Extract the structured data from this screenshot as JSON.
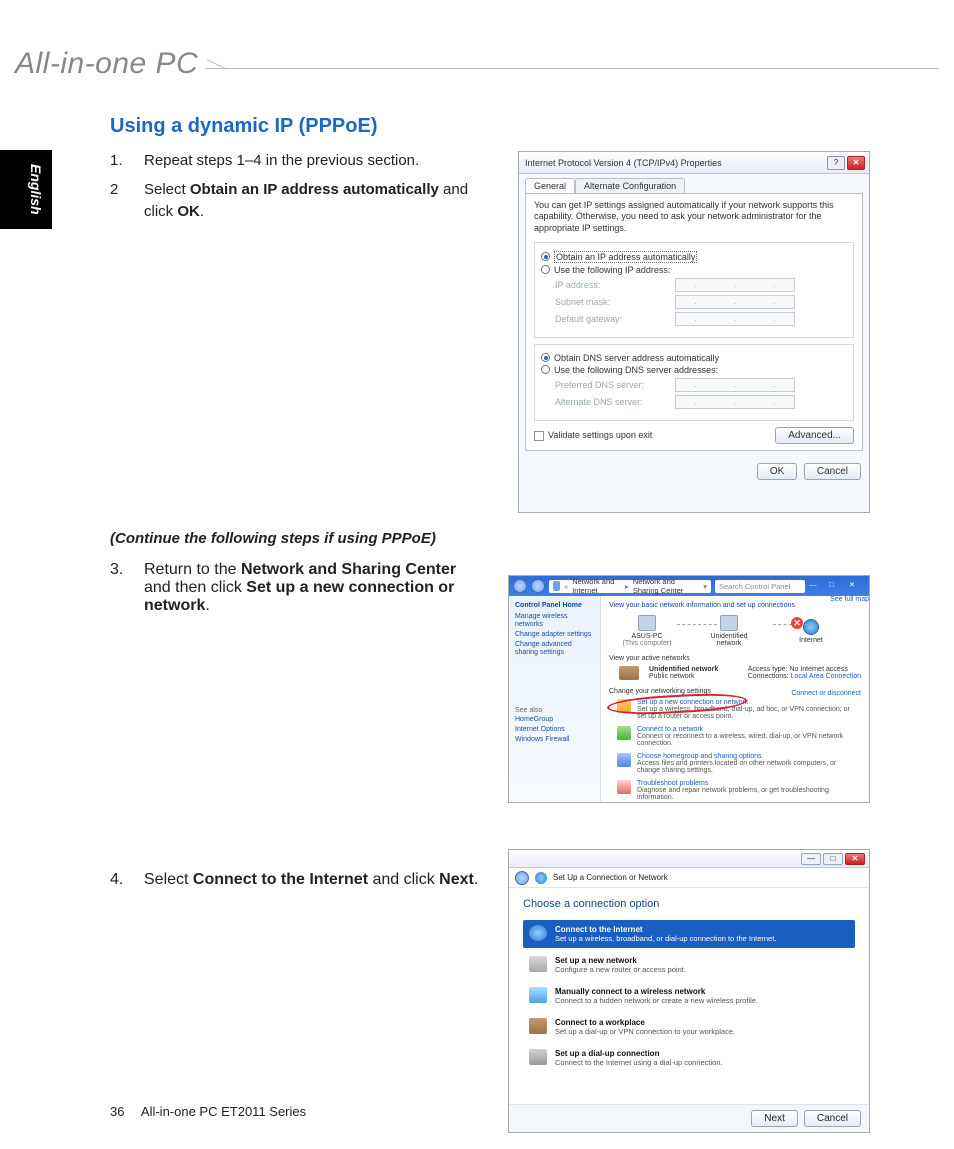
{
  "header": {
    "product": "All-in-one PC"
  },
  "lang_tab": "English",
  "section_title": "Using a dynamic IP (PPPoE)",
  "steps": {
    "s1": {
      "n": "1.",
      "t": "Repeat steps 1–4 in the previous section."
    },
    "s2": {
      "n": "2",
      "pre": "Select ",
      "b1": "Obtain an IP address automatically",
      "mid": " and click ",
      "b2": "OK",
      "post": "."
    },
    "cont": "(Continue the following steps if using PPPoE)",
    "s3": {
      "n": "3.",
      "pre": "Return to the ",
      "b1": "Network and Sharing Center",
      "mid": " and then click ",
      "b2": "Set up a new connection or network",
      "post": "."
    },
    "s4": {
      "n": "4.",
      "pre": "Select ",
      "b1": "Connect to the Internet",
      "mid": " and click ",
      "b2": "Next",
      "post": "."
    }
  },
  "shot1": {
    "title": "Internet Protocol Version 4 (TCP/IPv4) Properties",
    "help_icon": "?",
    "close_icon": "✕",
    "tab_general": "General",
    "tab_alt": "Alternate Configuration",
    "intro": "You can get IP settings assigned automatically if your network supports this capability. Otherwise, you need to ask your network administrator for the appropriate IP settings.",
    "r_auto_ip": "Obtain an IP address automatically",
    "r_use_ip": "Use the following IP address:",
    "f_ip": "IP address:",
    "f_mask": "Subnet mask:",
    "f_gw": "Default gateway:",
    "r_auto_dns": "Obtain DNS server address automatically",
    "r_use_dns": "Use the following DNS server addresses:",
    "f_pdns": "Preferred DNS server:",
    "f_adns": "Alternate DNS server:",
    "chk_validate": "Validate settings upon exit",
    "btn_adv": "Advanced...",
    "btn_ok": "OK",
    "btn_cancel": "Cancel"
  },
  "shot2": {
    "bc1": "Network and Internet",
    "bc2": "Network and Sharing Center",
    "search_ph": "Search Control Panel",
    "cph": "Control Panel Home",
    "side1": "Manage wireless networks",
    "side2": "Change adapter settings",
    "side3": "Change advanced sharing settings",
    "seealso": "See also",
    "sa1": "HomeGroup",
    "sa2": "Internet Options",
    "sa3": "Windows Firewall",
    "hdr": "View your basic network information and set up connections",
    "fullmap": "See full map",
    "node1": "ASUS-PC",
    "node1b": "(This computer)",
    "node2": "Unidentified network",
    "node3": "Internet",
    "viewact": "View your active networks",
    "disconnect": "Connect or disconnect",
    "net_name": "Unidentified network",
    "net_type": "Public network",
    "at": "Access type:",
    "atv": "No Internet access",
    "cn": "Connections:",
    "cnv": "Local Area Connection",
    "chg": "Change your networking settings",
    "c1t": "Set up a new connection or network",
    "c1s": "Set up a wireless, broadband, dial-up, ad hoc, or VPN connection; or set up a router or access point.",
    "c2t": "Connect to a network",
    "c2s": "Connect or reconnect to a wireless, wired, dial-up, or VPN network connection.",
    "c3t": "Choose homegroup and sharing options",
    "c3s": "Access files and printers located on other network computers, or change sharing settings.",
    "c4t": "Troubleshoot problems",
    "c4s": "Diagnose and repair network problems, or get troubleshooting information."
  },
  "shot3": {
    "title": "Set Up a Connection or Network",
    "heading": "Choose a connection option",
    "o1t": "Connect to the Internet",
    "o1s": "Set up a wireless, broadband, or dial-up connection to the Internet.",
    "o2t": "Set up a new network",
    "o2s": "Configure a new router or access point.",
    "o3t": "Manually connect to a wireless network",
    "o3s": "Connect to a hidden network or create a new wireless profile.",
    "o4t": "Connect to a workplace",
    "o4s": "Set up a dial-up or VPN connection to your workplace.",
    "o5t": "Set up a dial-up connection",
    "o5s": "Connect to the Internet using a dial-up connection.",
    "btn_next": "Next",
    "btn_cancel": "Cancel",
    "min": "—",
    "max": "□",
    "close": "✕"
  },
  "footer": {
    "page": "36",
    "text": "All-in-one PC ET2011 Series"
  }
}
